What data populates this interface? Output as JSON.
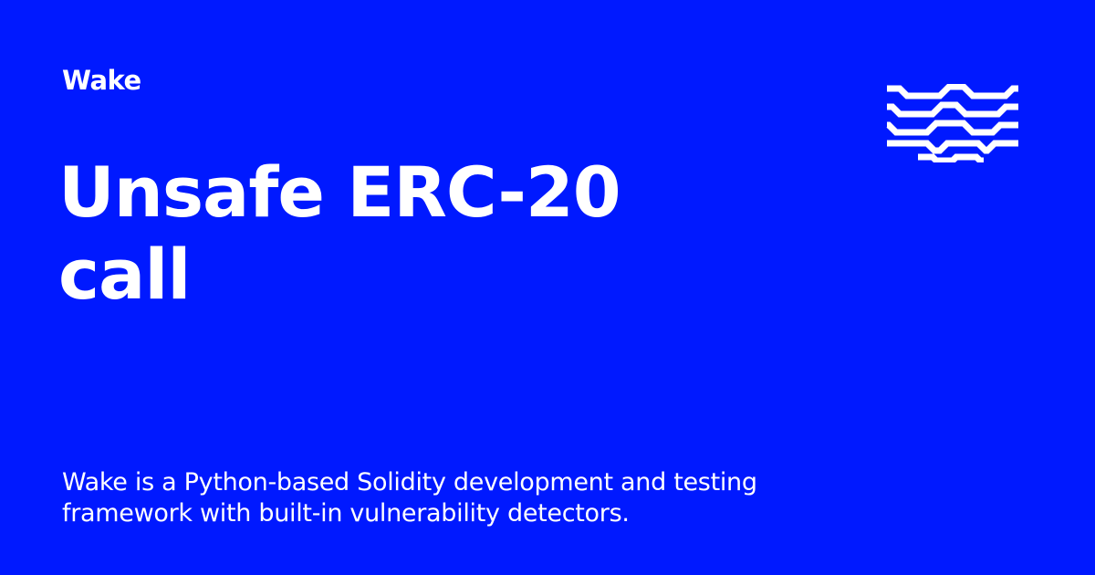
{
  "brand": "Wake",
  "title": "Unsafe ERC-20 call",
  "description": "Wake is a Python-based Solidity development and testing framework with built-in vulnerability detectors.",
  "colors": {
    "background": "#0019ff",
    "foreground": "#ffffff"
  },
  "logo_icon": "wake-wave-lines-logo-icon"
}
